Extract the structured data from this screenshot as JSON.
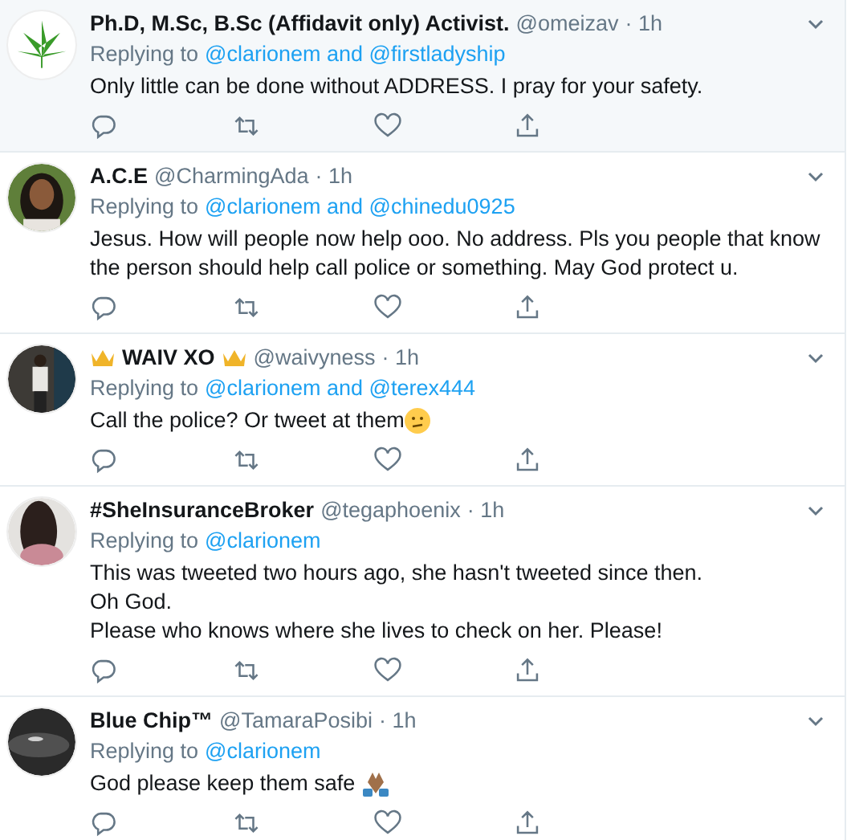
{
  "tweets": [
    {
      "name": "Ph.D, M.Sc, B.Sc (Affidavit only) Activist.",
      "crowns": false,
      "handle": "@omeizav",
      "time": "· 1h",
      "replying_label": "Replying to",
      "replying_to": "@clarionem and @firstladyship",
      "lines": [
        "Only little can be done without ADDRESS. I pray for your safety."
      ],
      "kind": "plain",
      "highlighted": true
    },
    {
      "name": "A.C.E",
      "crowns": false,
      "handle": "@CharmingAda",
      "time": "· 1h",
      "replying_label": "Replying to",
      "replying_to": "@clarionem and @chinedu0925",
      "lines": [
        "Jesus. How will people now help ooo. No address. Pls you people that know the person should help call police or something. May God protect u."
      ],
      "kind": "plain",
      "highlighted": false
    },
    {
      "name": "WAIV XO",
      "crowns": true,
      "handle": "@waivyness",
      "time": "· 1h",
      "replying_label": "Replying to",
      "replying_to": "@clarionem and @terex444",
      "lines": [
        "Call the police? Or tweet at them"
      ],
      "kind": "confused",
      "highlighted": false
    },
    {
      "name": "#SheInsuranceBroker",
      "crowns": false,
      "handle": "@tegaphoenix",
      "time": "· 1h",
      "replying_label": "Replying to",
      "replying_to": "@clarionem",
      "lines": [
        "This was tweeted two hours ago, she hasn't tweeted since then.",
        "Oh God.",
        "Please who knows where she lives to check on her. Please!"
      ],
      "kind": "plain",
      "highlighted": false
    },
    {
      "name": "Blue Chip™",
      "crowns": false,
      "handle": "@TamaraPosibi",
      "time": "· 1h",
      "replying_label": "Replying to",
      "replying_to": "@clarionem",
      "lines": [
        "God please keep them safe"
      ],
      "kind": "pray",
      "highlighted": false
    }
  ]
}
